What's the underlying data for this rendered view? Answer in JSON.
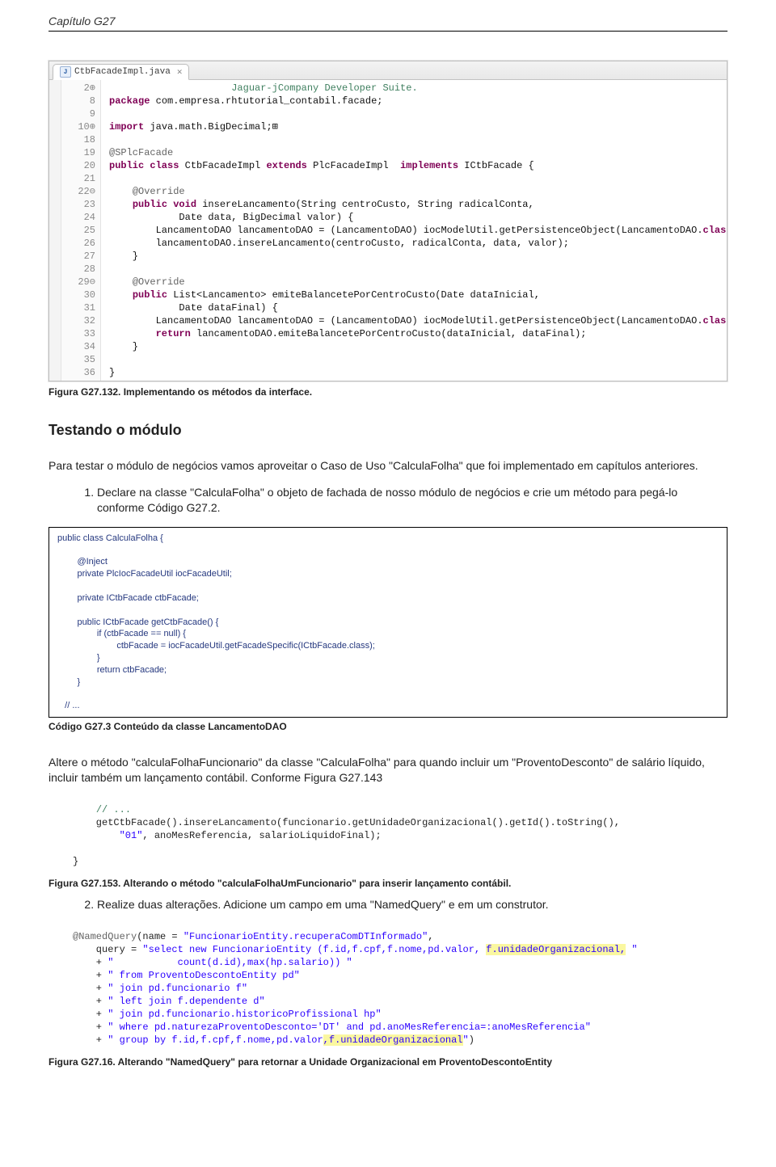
{
  "page_header": "Capítulo G27",
  "eclipse": {
    "tab_label": "CtbFacadeImpl.java",
    "lines": [
      {
        "n": "2⊕",
        "cls": "fold",
        "code": "<span class='cm'>                     Jaguar-jCompany Developer Suite.</span>"
      },
      {
        "n": "8",
        "code": "<span class='kw'>package</span> com.empresa.rhtutorial_contabil.facade;"
      },
      {
        "n": "9",
        "code": ""
      },
      {
        "n": "10⊕",
        "cls": "fold",
        "code": "<span class='kw'>import</span> java.math.BigDecimal;⊞"
      },
      {
        "n": "18",
        "code": ""
      },
      {
        "n": "19",
        "code": "<span class='ann'>@SPlcFacade</span>"
      },
      {
        "n": "20",
        "code": "<span class='kw'>public class</span> CtbFacadeImpl <span class='kw'>extends</span> PlcFacadeImpl  <span class='kw'>implements</span> ICtbFacade {"
      },
      {
        "n": "21",
        "code": ""
      },
      {
        "n": "22⊖",
        "cls": "fold",
        "code": "    <span class='ann'>@Override</span>"
      },
      {
        "n": "23",
        "code": "    <span class='kw'>public void</span> insereLancamento(String centroCusto, String radicalConta,"
      },
      {
        "n": "24",
        "code": "            Date data, BigDecimal valor) {"
      },
      {
        "n": "25",
        "code": "        LancamentoDAO lancamentoDAO = (LancamentoDAO) iocModelUtil.getPersistenceObject(LancamentoDAO.<span class='kw'>class</span>);"
      },
      {
        "n": "26",
        "code": "        lancamentoDAO.insereLancamento(centroCusto, radicalConta, data, valor);"
      },
      {
        "n": "27",
        "code": "    }"
      },
      {
        "n": "28",
        "code": ""
      },
      {
        "n": "29⊖",
        "cls": "fold",
        "code": "    <span class='ann'>@Override</span>"
      },
      {
        "n": "30",
        "code": "    <span class='kw'>public</span> List&lt;Lancamento&gt; emiteBalancetePorCentroCusto(Date dataInicial,"
      },
      {
        "n": "31",
        "code": "            Date dataFinal) {"
      },
      {
        "n": "32",
        "code": "        LancamentoDAO lancamentoDAO = (LancamentoDAO) iocModelUtil.getPersistenceObject(LancamentoDAO.<span class='kw'>class</span>);"
      },
      {
        "n": "33",
        "code": "        <span class='kw'>return</span> lancamentoDAO.emiteBalancetePorCentroCusto(dataInicial, dataFinal);"
      },
      {
        "n": "34",
        "code": "    }"
      },
      {
        "n": "35",
        "code": ""
      },
      {
        "n": "36",
        "code": "}"
      }
    ]
  },
  "caption_fig1": "Figura G27.132. Implementando os métodos da interface.",
  "section_heading": "Testando o módulo",
  "para1": "Para testar o módulo de negócios vamos aproveitar o Caso de Uso \"CalculaFolha\" que foi implementado em capítulos anteriores.",
  "step1": "Declare na classe \"CalculaFolha\" o objeto de fachada de nosso módulo de negócios e crie um método para pegá-lo conforme Código G27.2.",
  "codebox": "public class CalculaFolha {\n\n        @Inject\n        private PlcIocFacadeUtil iocFacadeUtil;\n\n        private ICtbFacade ctbFacade;\n\n        public ICtbFacade getCtbFacade() {\n                if (ctbFacade == null) {\n                        ctbFacade = iocFacadeUtil.getFacadeSpecific(ICtbFacade.class);\n                }\n                return ctbFacade;\n        }\n\n   // ...",
  "codebox_caption": "Código G27.3 Conteúdo da classe LancamentoDAO",
  "para2": "Altere o método \"calculaFolhaFuncionario\" da classe \"CalculaFolha\" para quando incluir um \"ProventoDesconto\" de salário líquido, incluir também um lançamento contábil. Conforme Figura G27.143",
  "snippet1": "    <span class='c-cm'>// ...</span>\n    getCtbFacade().insereLancamento(funcionario.getUnidadeOrganizacional().getId().toString(),\n        <span class='c-str'>\"01\"</span>, anoMesReferencia, salarioLiquidoFinal);\n\n}",
  "caption_fig2": "Figura G27.153. Alterando o método \"calculaFolhaUmFuncionario\" para inserir lançamento contábil.",
  "step2": "Realize duas alterações. Adicione um campo em uma \"NamedQuery\" e em um construtor.",
  "snippet2": "<span class='ann'>@NamedQuery</span>(name = <span class='c-str'>\"FuncionarioEntity.recuperaComDTInformado\"</span>,\n    query = <span class='c-str'>\"select new FuncionarioEntity (f.id,f.cpf,f.nome,pd.valor, <span class='hl'>f.unidadeOrganizacional,</span> \"</span>\n    + <span class='c-str'>\"           count(d.id),max(hp.salario)) \"</span>\n    + <span class='c-str'>\" from ProventoDescontoEntity pd\"</span>\n    + <span class='c-str'>\" join pd.funcionario f\"</span>\n    + <span class='c-str'>\" left join f.dependente d\"</span>\n    + <span class='c-str'>\" join pd.funcionario.historicoProfissional hp\"</span>\n    + <span class='c-str'>\" where pd.naturezaProventoDesconto='DT' and pd.anoMesReferencia=:anoMesReferencia\"</span>\n    + <span class='c-str'>\" group by f.id,f.cpf,f.nome,pd.valor<span class='hl'>,f.unidadeOrganizacional</span>\"</span>)",
  "caption_fig3": "Figura G27.16. Alterando \"NamedQuery\" para retornar a Unidade Organizacional em ProventoDescontoEntity"
}
